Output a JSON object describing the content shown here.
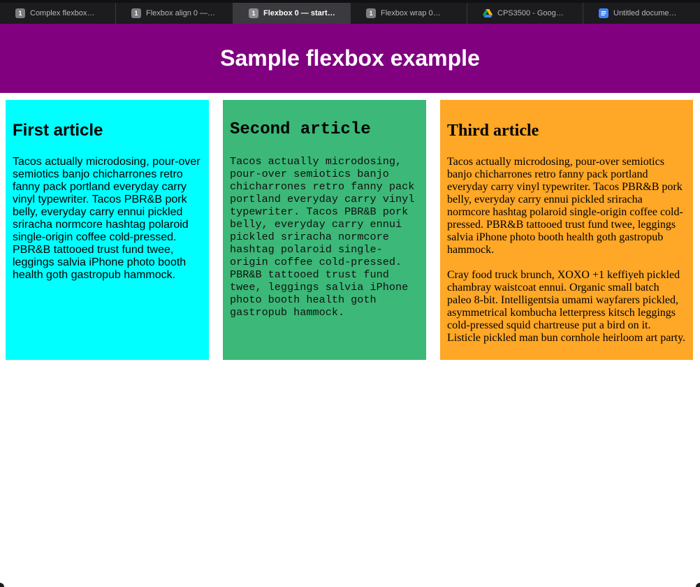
{
  "browser": {
    "tabs": [
      {
        "title": "Complex flexbox…",
        "favicon": "1",
        "icon": "document-tab-icon",
        "active": false
      },
      {
        "title": "Flexbox align 0 —…",
        "favicon": "1",
        "icon": "document-tab-icon",
        "active": false
      },
      {
        "title": "Flexbox 0 — start…",
        "favicon": "1",
        "icon": "document-tab-icon",
        "active": true
      },
      {
        "title": "Flexbox wrap 0…",
        "favicon": "1",
        "icon": "document-tab-icon",
        "active": false
      },
      {
        "title": "CPS3500 - Goog…",
        "favicon": "",
        "icon": "google-drive-icon",
        "active": false
      },
      {
        "title": "Untitled docume…",
        "favicon": "",
        "icon": "google-docs-icon",
        "active": false
      }
    ]
  },
  "header": {
    "title": "Sample flexbox example",
    "background": "#800080"
  },
  "articles": [
    {
      "title": "First article",
      "background": "#00ffff",
      "paragraphs": [
        "Tacos actually microdosing, pour-over semiotics banjo chicharrones retro fanny pack portland everyday carry vinyl typewriter. Tacos PBR&B pork belly, everyday carry ennui pickled sriracha normcore hashtag polaroid single-origin coffee cold-pressed. PBR&B tattooed trust fund twee, leggings salvia iPhone photo booth health goth gastropub hammock."
      ]
    },
    {
      "title": "Second article",
      "background": "#3cb878",
      "paragraphs": [
        "Tacos actually microdosing, pour-over semiotics banjo chicharrones retro fanny pack portland everyday carry vinyl typewriter. Tacos PBR&B pork belly, everyday carry ennui pickled sriracha normcore hashtag polaroid single-origin coffee cold-pressed. PBR&B tattooed trust fund twee, leggings salvia iPhone photo booth health goth gastropub hammock."
      ]
    },
    {
      "title": "Third article",
      "background": "#ffa726",
      "paragraphs": [
        "Tacos actually microdosing, pour-over semiotics banjo chicharrones retro fanny pack portland everyday carry vinyl typewriter. Tacos PBR&B pork belly, everyday carry ennui pickled sriracha normcore hashtag polaroid single-origin coffee cold-pressed. PBR&B tattooed trust fund twee, leggings salvia iPhone photo booth health goth gastropub hammock.",
        "Cray food truck brunch, XOXO +1 keffiyeh pickled chambray waistcoat ennui. Organic small batch paleo 8-bit. Intelligentsia umami wayfarers pickled, asymmetrical kombucha letterpress kitsch leggings cold-pressed squid chartreuse put a bird on it. Listicle pickled man bun cornhole heirloom art party."
      ]
    }
  ]
}
